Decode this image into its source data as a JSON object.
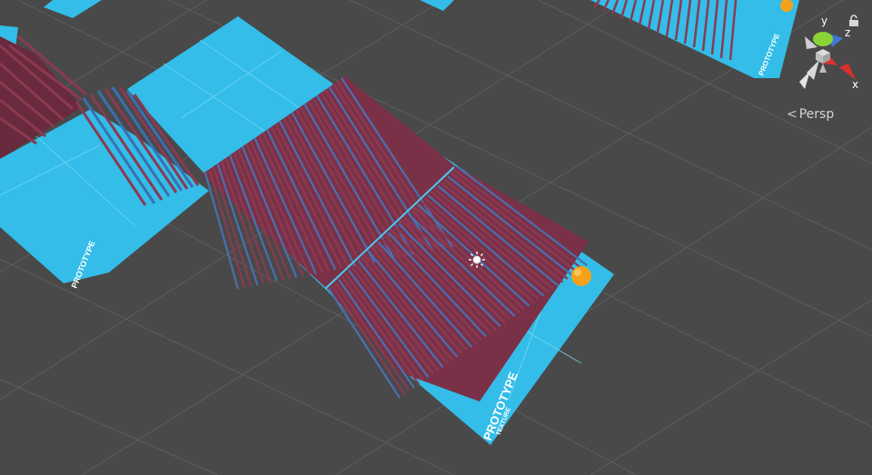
{
  "scene_view": {
    "projection_label": "Persp",
    "projection_icon": "chevron-left-icon",
    "lock_icon": "lock-icon",
    "background_color": "#494949",
    "grid_color": "#5c5c5c",
    "platform_color": "#33bde8",
    "obstacle_color": "#8a3a52",
    "ball_color": "#f5a21a"
  },
  "gizmo": {
    "axis_y": "y",
    "axis_z": "z",
    "axis_x": "x",
    "y_color": "#8bd335",
    "z_color": "#3d7ad6",
    "x_color": "#d9302a"
  },
  "platform_texts": {
    "prototype_label": "PROTOTYPE",
    "texture_label": "TEXTURE"
  }
}
